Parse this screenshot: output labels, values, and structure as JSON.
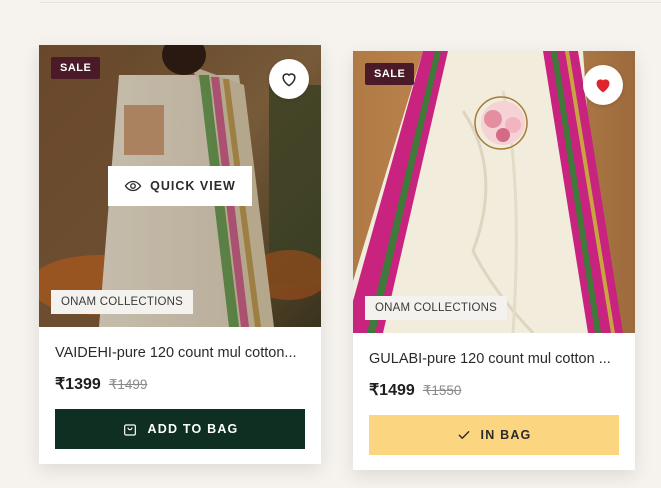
{
  "products": [
    {
      "badge": "SALE",
      "wishlist_icon": "heart-outline-icon",
      "quick_view_label": "QUICK VIEW",
      "collection": "ONAM COLLECTIONS",
      "title": "VAIDEHI-pure 120 count mul cotton...",
      "price": "₹1399",
      "mrp": "₹1499",
      "button_label": "ADD TO BAG",
      "button_icon": "shopping-bag-icon",
      "wishlisted": false
    },
    {
      "badge": "SALE",
      "wishlist_icon": "heart-filled-icon",
      "collection": "ONAM COLLECTIONS",
      "title": "GULABI-pure 120 count mul cotton ...",
      "price": "₹1499",
      "mrp": "₹1550",
      "button_label": "IN BAG",
      "button_icon": "check-icon",
      "wishlisted": true
    }
  ],
  "colors": {
    "sale_badge": "#4a1a28",
    "add_to_bag": "#0f2f22",
    "in_bag": "#fcd581",
    "wishlist_active": "#e0242f"
  }
}
